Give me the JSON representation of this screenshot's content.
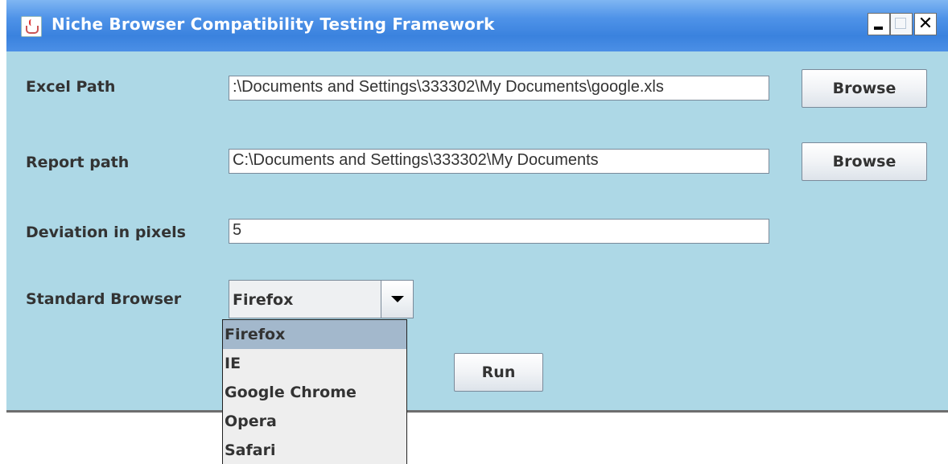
{
  "window": {
    "title": "Niche Browser Compatibility Testing Framework",
    "controls": {
      "minimize": "minimize",
      "maximize": "maximize",
      "close": "✕"
    }
  },
  "form": {
    "excel_path": {
      "label": "Excel Path",
      "value": ":\\Documents and Settings\\333302\\My Documents\\google.xls",
      "browse_label": "Browse"
    },
    "report_path": {
      "label": "Report path",
      "value": "C:\\Documents and Settings\\333302\\My Documents",
      "browse_label": "Browse"
    },
    "deviation": {
      "label": "Deviation in pixels",
      "value": "5"
    },
    "standard_browser": {
      "label": "Standard Browser",
      "selected": "Firefox",
      "options": [
        "Firefox",
        "IE",
        "Google Chrome",
        "Opera",
        "Safari"
      ],
      "highlighted_index": 0
    },
    "run_label": "Run"
  },
  "icons": {
    "app": "java-coffee-cup-icon",
    "dropdown": "chevron-down-icon"
  },
  "colors": {
    "window_background": "#add8e6",
    "titlebar": "#3a82de",
    "selected_option": "#a3b8cc"
  }
}
